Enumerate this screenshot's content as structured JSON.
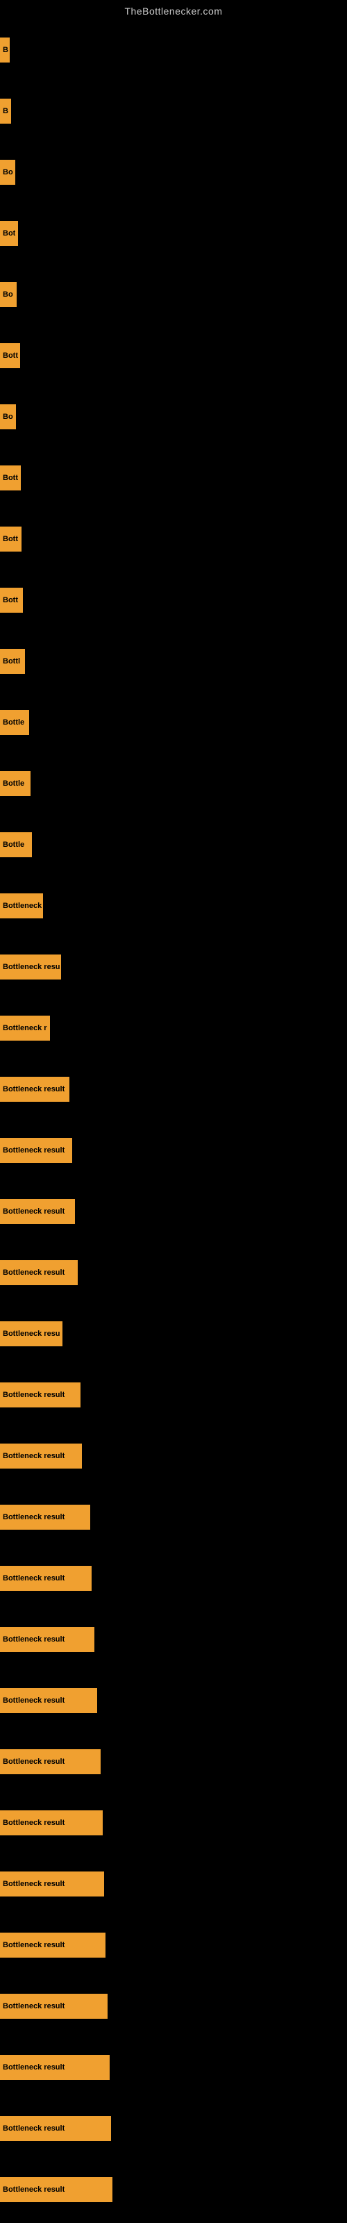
{
  "site": {
    "title": "TheBottlenecker.com"
  },
  "bars": [
    {
      "label": "B",
      "width": 14
    },
    {
      "label": "B",
      "width": 16
    },
    {
      "label": "Bo",
      "width": 22
    },
    {
      "label": "Bot",
      "width": 26
    },
    {
      "label": "Bo",
      "width": 24
    },
    {
      "label": "Bott",
      "width": 29
    },
    {
      "label": "Bo",
      "width": 23
    },
    {
      "label": "Bott",
      "width": 30
    },
    {
      "label": "Bott",
      "width": 31
    },
    {
      "label": "Bott",
      "width": 33
    },
    {
      "label": "Bottl",
      "width": 36
    },
    {
      "label": "Bottle",
      "width": 42
    },
    {
      "label": "Bottle",
      "width": 44
    },
    {
      "label": "Bottle",
      "width": 46
    },
    {
      "label": "Bottleneck",
      "width": 62
    },
    {
      "label": "Bottleneck resu",
      "width": 88
    },
    {
      "label": "Bottleneck r",
      "width": 72
    },
    {
      "label": "Bottleneck result",
      "width": 100
    },
    {
      "label": "Bottleneck result",
      "width": 104
    },
    {
      "label": "Bottleneck result",
      "width": 108
    },
    {
      "label": "Bottleneck result",
      "width": 112
    },
    {
      "label": "Bottleneck resu",
      "width": 90
    },
    {
      "label": "Bottleneck result",
      "width": 116
    },
    {
      "label": "Bottleneck result",
      "width": 118
    },
    {
      "label": "Bottleneck result",
      "width": 130
    },
    {
      "label": "Bottleneck result",
      "width": 132
    },
    {
      "label": "Bottleneck result",
      "width": 136
    },
    {
      "label": "Bottleneck result",
      "width": 140
    },
    {
      "label": "Bottleneck result",
      "width": 145
    },
    {
      "label": "Bottleneck result",
      "width": 148
    },
    {
      "label": "Bottleneck result",
      "width": 150
    },
    {
      "label": "Bottleneck result",
      "width": 152
    },
    {
      "label": "Bottleneck result",
      "width": 155
    },
    {
      "label": "Bottleneck result",
      "width": 158
    },
    {
      "label": "Bottleneck result",
      "width": 160
    },
    {
      "label": "Bottleneck result",
      "width": 162
    }
  ]
}
